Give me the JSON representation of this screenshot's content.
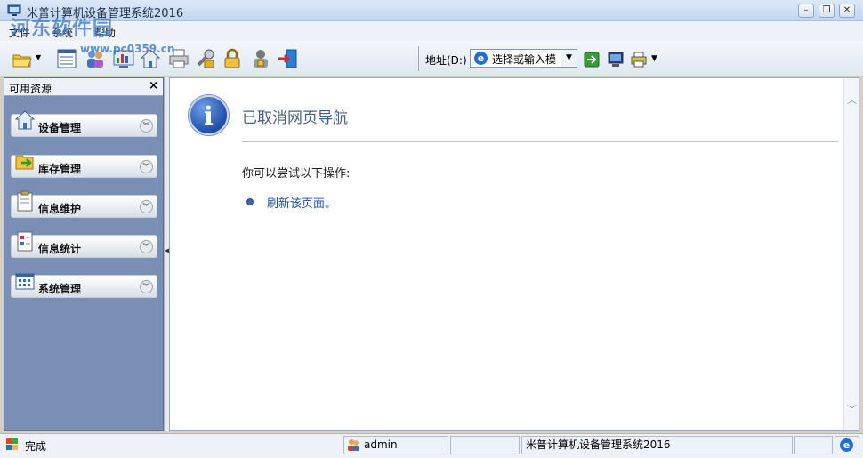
{
  "window": {
    "title": "米普计算机设备管理系统2016",
    "controls": [
      "minimize",
      "restore",
      "close"
    ]
  },
  "watermark": {
    "text": "河东软件园",
    "url": "www.pc0359.cn"
  },
  "menu": [
    "文件",
    "系统",
    "帮助"
  ],
  "toolbar": {
    "address_label": "地址(D:)",
    "address_value": "选择或输入模",
    "icons": [
      "open-folder-icon",
      "list-icon",
      "users-icon",
      "report-icon",
      "home-icon",
      "print-icon",
      "tools-icon",
      "lock-icon",
      "user-lock-icon",
      "exit-icon",
      "go-icon",
      "monitor-icon",
      "printer-settings-icon"
    ]
  },
  "left_panel": {
    "title": "可用资源",
    "close": "×",
    "groups": [
      {
        "label": "设备管理",
        "icon": "home-icon"
      },
      {
        "label": "库存管理",
        "icon": "folder-arrow-icon"
      },
      {
        "label": "信息维护",
        "icon": "clipboard-icon"
      },
      {
        "label": "信息统计",
        "icon": "chart-document-icon"
      },
      {
        "label": "系统管理",
        "icon": "grid-window-icon"
      }
    ]
  },
  "content": {
    "heading": "已取消网页导航",
    "tip": "你可以尝试以下操作:",
    "link": "刷新该页面。"
  },
  "statusbar": {
    "status": "完成",
    "user": "admin",
    "app_name": "米普计算机设备管理系统2016"
  },
  "colors": {
    "panel_bg": "#7a8fb5",
    "heading": "#4a5e80",
    "link": "#1f4fa8"
  }
}
